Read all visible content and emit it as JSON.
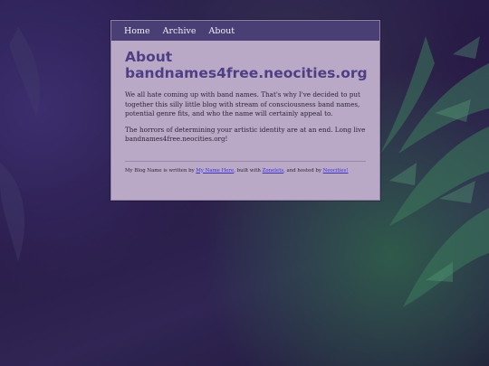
{
  "nav": {
    "items": [
      {
        "label": "Home"
      },
      {
        "label": "Archive"
      },
      {
        "label": "About"
      }
    ]
  },
  "page": {
    "title": "About bandnames4free.neocities.org",
    "paragraphs": [
      "We all hate coming up with band names. That's why I've decided to put together this silly little blog with stream of consciousness band names, potential genre fits, and who the name will certainly appeal to.",
      "The horrors of determining your artistic identity are at an end. Long live bandnames4free.neocities.org!"
    ]
  },
  "footer": {
    "text1": "My Blog Name is written by ",
    "link1": "My Name Here",
    "text2": ", built with ",
    "link2": "Zonelets",
    "text3": ", and hosted by ",
    "link3": "Neocities!"
  },
  "colors": {
    "card_bg": "#b9a9c6",
    "nav_bg": "#4a3f74",
    "title": "#4e3f85",
    "link": "#3d2ecf"
  }
}
